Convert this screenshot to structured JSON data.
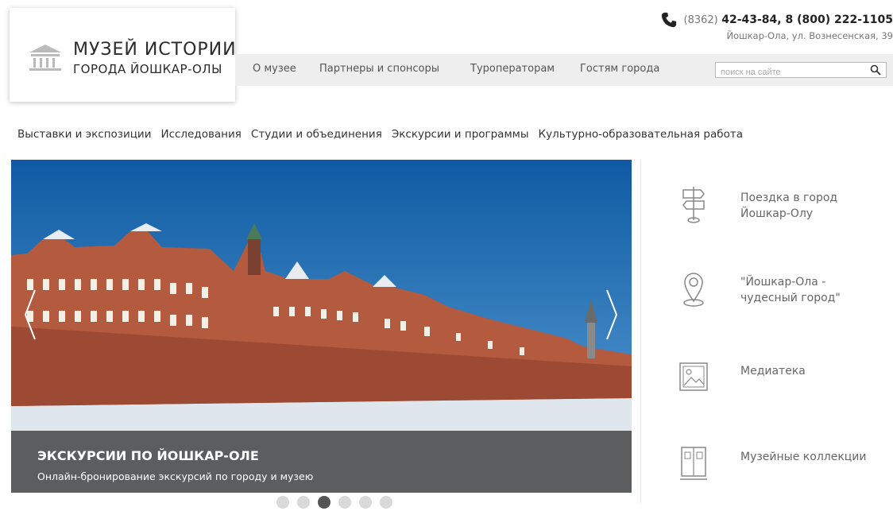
{
  "logo": {
    "line1": "Музей истории",
    "line2": "города Йошкар-Олы",
    "icon": "museum-building-icon"
  },
  "contacts": {
    "phone_code": "(8362)",
    "phone_numbers": "42-43-84, 8 (800) 222-1105",
    "address": "Йошкар-Ола, ул. Вознесенская, 39",
    "icon": "phone-icon"
  },
  "topnav": {
    "items": [
      "О музее",
      "Партнеры и спонсоры",
      "Туроператорам",
      "Гостям города"
    ]
  },
  "search": {
    "placeholder": "поиск на сайте",
    "icon": "search-icon"
  },
  "mainnav": {
    "items": [
      "Выставки и экспозиции",
      "Исследования",
      "Студии и объединения",
      "Экскурсии и программы",
      "Культурно-образовательная работа"
    ]
  },
  "slider": {
    "title": "Экскурсии по Йошкар-Оле",
    "subtitle": "Онлайн-бронирование экскурсий по городу и музею",
    "slide_count": 6,
    "active_slide": 3
  },
  "sidebar": {
    "items": [
      {
        "label": "Поездка в город Йошкар-Олу",
        "icon": "signpost-icon"
      },
      {
        "label": "\"Йошкар-Ола - чудесный город\"",
        "icon": "map-pin-icon"
      },
      {
        "label": "Медиатека",
        "icon": "picture-icon"
      },
      {
        "label": "Музейные коллекции",
        "icon": "cabinet-icon"
      }
    ]
  },
  "colors": {
    "nav_background": "#eeeeee",
    "caption_overlay": "#282828",
    "sky": "#1f6fb3",
    "brick": "#b45a3f"
  }
}
